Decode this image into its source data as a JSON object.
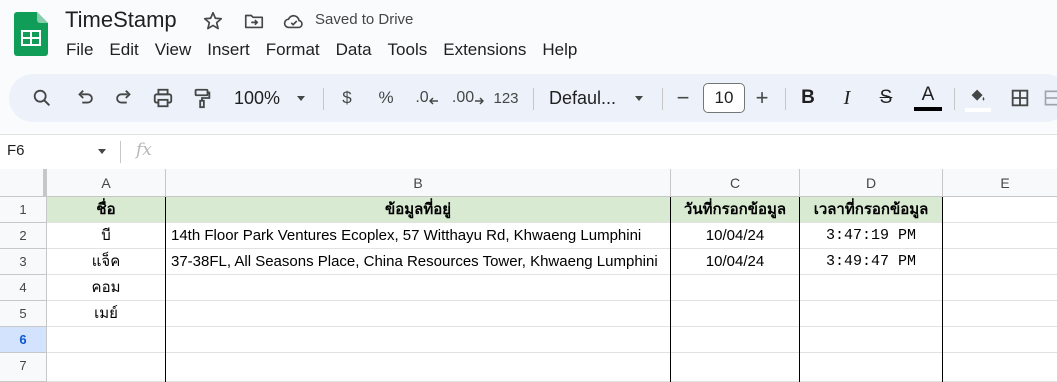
{
  "app": {
    "doc_title": "TimeStamp",
    "saved_status": "Saved to Drive"
  },
  "menu": [
    "File",
    "Edit",
    "View",
    "Insert",
    "Format",
    "Data",
    "Tools",
    "Extensions",
    "Help"
  ],
  "toolbar": {
    "zoom": "100%",
    "currency_label": "$",
    "percent_label": "%",
    "decrease_decimal_label": ".0",
    "increase_decimal_label": ".00",
    "more_formats_label": "123",
    "font_name": "Defaul...",
    "font_size": "10",
    "minus_label": "−",
    "plus_label": "+",
    "bold_label": "B",
    "italic_label": "I",
    "strike_label": "S",
    "text_color_label": "A"
  },
  "formula_bar": {
    "cell_ref": "F6",
    "fx_label": "fx",
    "content": ""
  },
  "sheet": {
    "columns": [
      "A",
      "B",
      "C",
      "D",
      "E"
    ],
    "rows": [
      "1",
      "2",
      "3",
      "4",
      "5",
      "6",
      "7"
    ],
    "selected_row": "6",
    "headers": {
      "a": "ชื่อ",
      "b": "ข้อมูลที่อยู่",
      "c": "วันที่กรอกข้อมูล",
      "d": "เวลาที่กรอกข้อมูล"
    },
    "data": [
      {
        "name": "บี",
        "address": "14th Floor Park Ventures Ecoplex, 57 Witthayu Rd, Khwaeng Lumphini",
        "date": "10/04/24",
        "time": "3:47:19 PM"
      },
      {
        "name": "แจ็ค",
        "address": "37-38FL, All Seasons Place, China Resources Tower, Khwaeng Lumphini",
        "date": "10/04/24",
        "time": "3:49:47 PM"
      },
      {
        "name": "คอม",
        "address": "",
        "date": "",
        "time": ""
      },
      {
        "name": "เมย์",
        "address": "",
        "date": "",
        "time": ""
      }
    ]
  },
  "colors": {
    "header_fill": "#d9ead3",
    "logo_green": "#0f9d58",
    "selected_row_fill": "#d3e3fd"
  }
}
